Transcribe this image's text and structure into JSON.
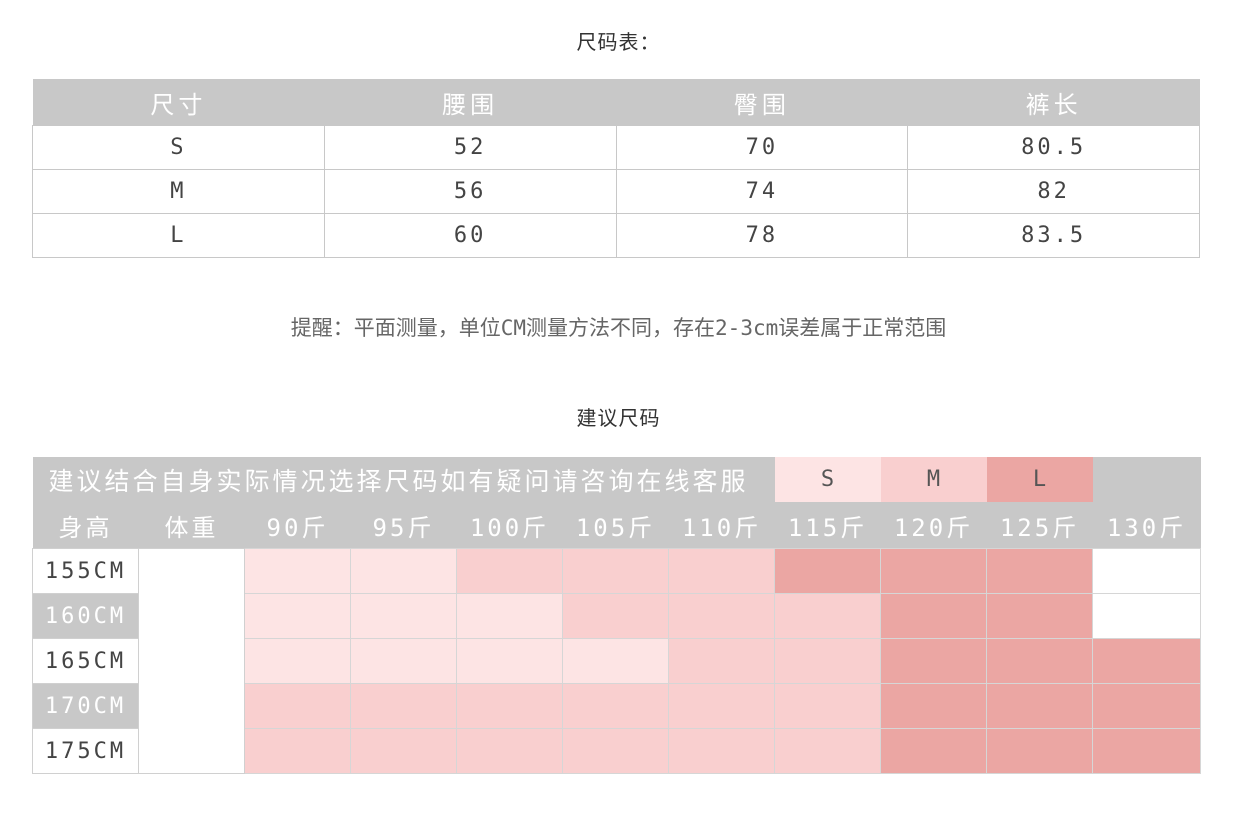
{
  "size_chart": {
    "title": "尺码表：",
    "headers": [
      "尺寸",
      "腰围",
      "臀围",
      "裤长"
    ],
    "rows": [
      [
        "S",
        "52",
        "70",
        "80.5"
      ],
      [
        "M",
        "56",
        "74",
        "82"
      ],
      [
        "L",
        "60",
        "78",
        "83.5"
      ]
    ]
  },
  "note": "提醒：平面测量，单位CM测量方法不同，存在2-3cm误差属于正常范围",
  "recommend": {
    "title": "建议尺码",
    "advice": "建议结合自身实际情况选择尺码如有疑问请咨询在线客服",
    "legend": [
      {
        "size": "S",
        "color": "#fde4e4"
      },
      {
        "size": "M",
        "color": "#f9cfcf"
      },
      {
        "size": "L",
        "color": "#eba6a3"
      }
    ],
    "height_header": "身高",
    "weight_header": "体重",
    "weights": [
      "90斤",
      "95斤",
      "100斤",
      "105斤",
      "110斤",
      "115斤",
      "120斤",
      "125斤",
      "130斤"
    ],
    "rows": [
      {
        "height": "155CM",
        "sizes": [
          "S",
          "S",
          "M",
          "M",
          "M",
          "L",
          "L",
          "L",
          ""
        ]
      },
      {
        "height": "160CM",
        "sizes": [
          "S",
          "S",
          "S",
          "M",
          "M",
          "M",
          "L",
          "L",
          ""
        ]
      },
      {
        "height": "165CM",
        "sizes": [
          "S",
          "S",
          "S",
          "S",
          "M",
          "M",
          "L",
          "L",
          "L"
        ]
      },
      {
        "height": "170CM",
        "sizes": [
          "M",
          "M",
          "M",
          "M",
          "M",
          "M",
          "L",
          "L",
          "L"
        ]
      },
      {
        "height": "175CM",
        "sizes": [
          "M",
          "M",
          "M",
          "M",
          "M",
          "M",
          "L",
          "L",
          "L"
        ]
      }
    ]
  }
}
